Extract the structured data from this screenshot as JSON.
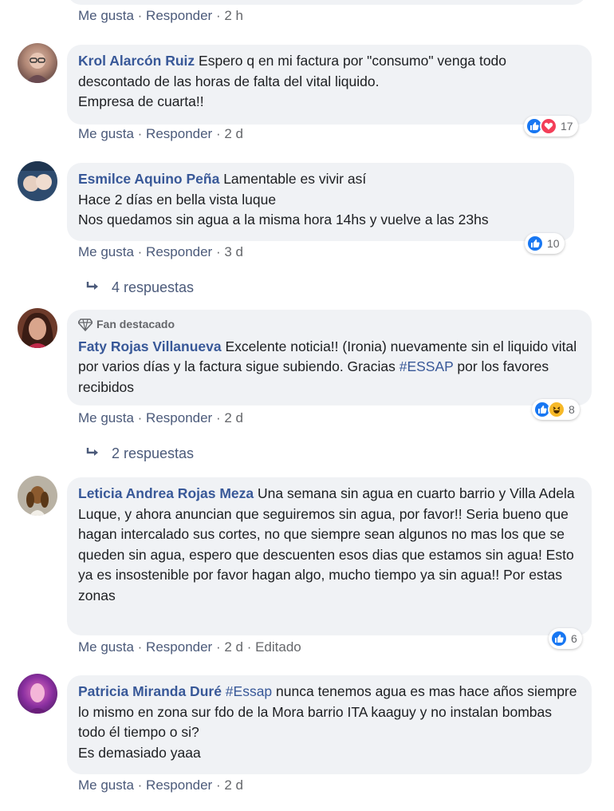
{
  "top_actions": {
    "like": "Me gusta",
    "reply": "Responder",
    "time": "2 h"
  },
  "comments": [
    {
      "name": "Krol Alarcón Ruiz",
      "text": "Espero q en mi factura por \"consumo\" venga todo descontado de las horas de falta del vital liquido.",
      "text2": "Empresa de cuarta!!",
      "reaction_count": "17",
      "reactions": [
        "like",
        "love"
      ],
      "like": "Me gusta",
      "reply": "Responder",
      "time": "2 d"
    },
    {
      "name": "Esmilce Aquino Peña",
      "text": "Lamentable es vivir así",
      "text2": "Hace 2 días en bella vista luque",
      "text3": "Nos quedamos sin agua a la misma hora 14hs y vuelve a las 23hs",
      "reaction_count": "10",
      "reactions": [
        "like"
      ],
      "like": "Me gusta",
      "reply": "Responder",
      "time": "3 d",
      "replies": "4 respuestas"
    },
    {
      "badge": "Fan destacado",
      "name": "Faty Rojas Villanueva",
      "text": "Excelente noticia!! (Ironia) nuevamente sin el liquido vital por varios días y la factura sigue subiendo. Gracias",
      "hashtag": "#ESSAP",
      "text2": "por los favores recibidos",
      "reaction_count": "8",
      "reactions": [
        "like",
        "haha"
      ],
      "like": "Me gusta",
      "reply": "Responder",
      "time": "2 d",
      "replies": "2 respuestas"
    },
    {
      "name": "Leticia Andrea Rojas Meza",
      "text": "Una semana sin agua en cuarto barrio y Villa Adela Luque, y ahora anuncian que seguiremos sin agua, por favor!! Seria bueno que hagan intercalado sus cortes, no que siempre sean algunos no mas los que se queden sin agua, espero que descuenten esos dias que estamos sin agua! Esto ya es insostenible por favor hagan algo, mucho tiempo ya sin agua!! Por estas zonas",
      "reaction_count": "6",
      "reactions": [
        "like"
      ],
      "like": "Me gusta",
      "reply": "Responder",
      "time": "2 d",
      "edited": "Editado"
    },
    {
      "name": "Patricia Miranda Duré",
      "hashtag": "#Essap",
      "text": "nunca tenemos agua es mas hace años siempre lo mismo en zona sur fdo de la Mora barrio ITA kaaguy y no instalan bombas todo él tiempo o si?",
      "text2": "Es demasiado yaaa",
      "like": "Me gusta",
      "reply": "Responder",
      "time": "2 d"
    }
  ],
  "colors": {
    "name": "#385898",
    "bubble": "#f0f2f5",
    "like": "#1877f2",
    "love": "#f33e58",
    "haha": "#f7b928"
  }
}
